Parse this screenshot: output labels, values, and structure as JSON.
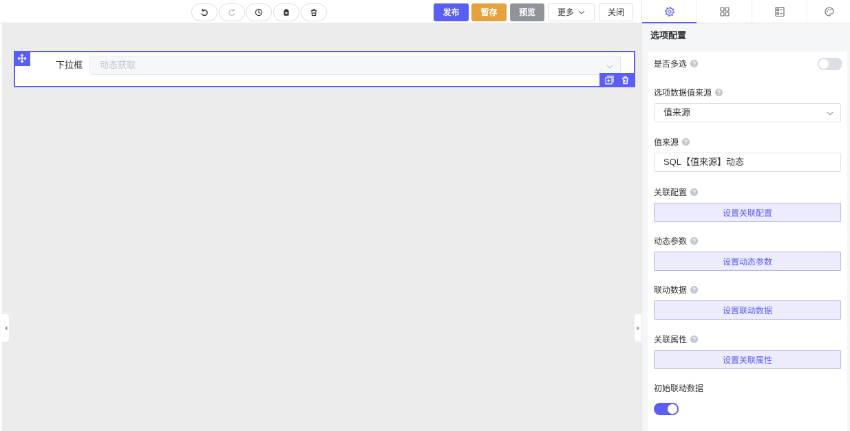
{
  "colors": {
    "accent": "#5b5ef3",
    "draft": "#e6a23c",
    "preview": "#909399",
    "canvas": "#ececec"
  },
  "toolbar": {
    "history_icons": [
      "undo-icon",
      "redo-icon",
      "history-icon",
      "clear-icon",
      "delete-icon"
    ],
    "publish_label": "发布",
    "draft_label": "暂存",
    "preview_label": "预览",
    "more_label": "更多",
    "close_label": "关闭"
  },
  "canvas": {
    "field": {
      "label": "下拉框",
      "placeholder": "动态获取"
    },
    "field_action_icons": [
      "copy-icon",
      "trash-icon"
    ]
  },
  "panel": {
    "tabs": [
      {
        "icon": "gear-icon",
        "active": true
      },
      {
        "icon": "grid-icon",
        "active": false
      },
      {
        "icon": "form-icon",
        "active": false
      },
      {
        "icon": "palette-icon",
        "active": false
      }
    ],
    "section_title": "选项配置",
    "multi_select": {
      "label": "是否多选",
      "value": false
    },
    "data_source": {
      "label": "选项数据值来源",
      "value": "值来源"
    },
    "value_source": {
      "label": "值来源",
      "value": "SQL【值来源】动态"
    },
    "relation_config": {
      "label": "关联配置",
      "button": "设置关联配置"
    },
    "dynamic_params": {
      "label": "动态参数",
      "button": "设置动态参数"
    },
    "linkage_data": {
      "label": "联动数据",
      "button": "设置联动数据"
    },
    "relation_attrs": {
      "label": "关联属性",
      "button": "设置关联属性"
    },
    "init_linkage": {
      "label": "初始联动数据",
      "value": true
    }
  }
}
